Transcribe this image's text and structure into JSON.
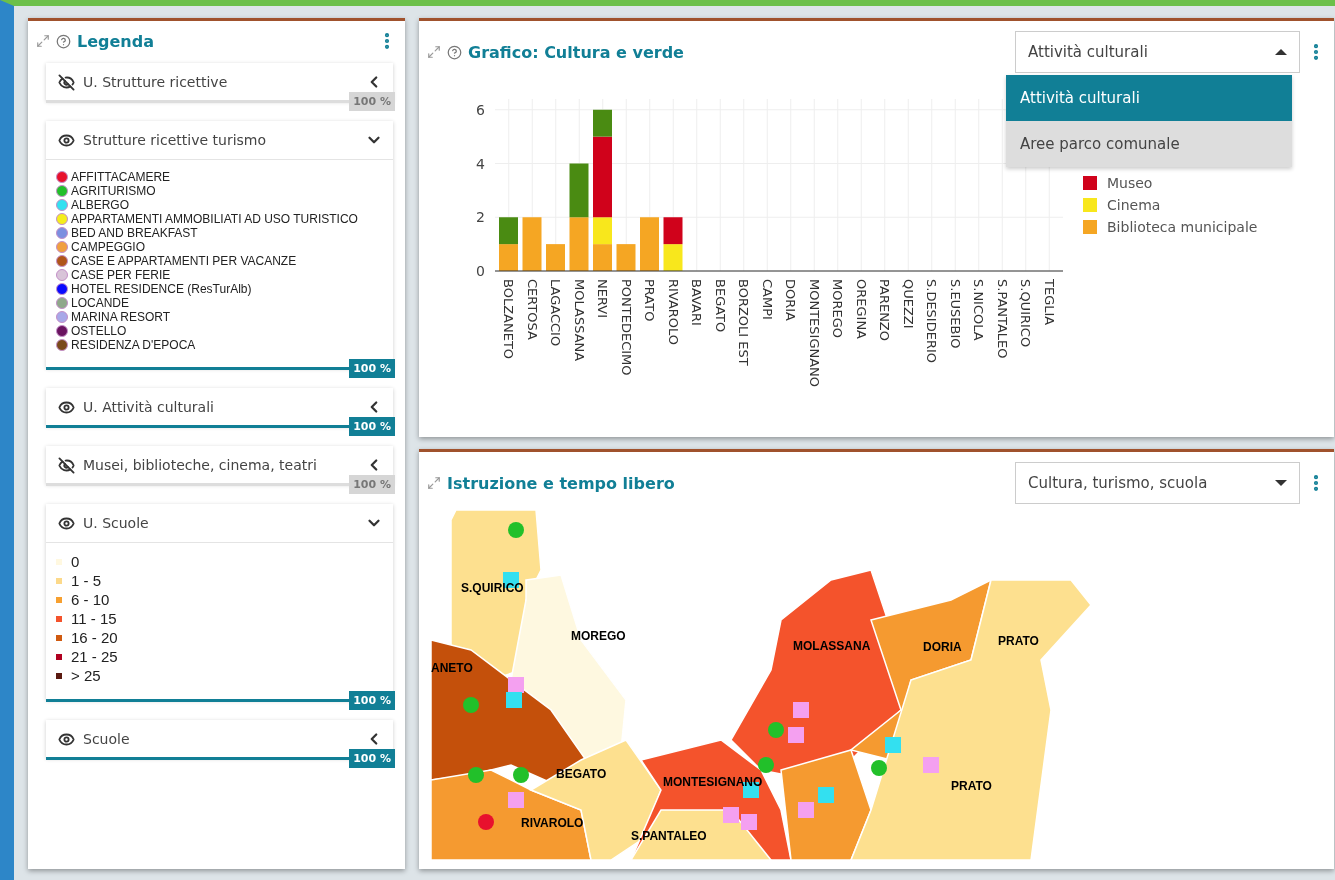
{
  "legend": {
    "title": "Legenda",
    "layers": [
      {
        "name": "U. Strutture ricettive",
        "visible": false,
        "expanded": false,
        "level": 1,
        "reading": "100 %"
      },
      {
        "name": "Strutture ricettive turismo",
        "visible": true,
        "expanded": true,
        "level": 1,
        "reading": "100 %",
        "kind": "points",
        "items": [
          {
            "label": "AFFITTACAMERE",
            "color": "#e8112d"
          },
          {
            "label": "AGRITURISMO",
            "color": "#22c02a"
          },
          {
            "label": "ALBERGO",
            "color": "#33e0f0"
          },
          {
            "label": "APPARTAMENTI AMMOBILIATI AD USO TURISTICO",
            "color": "#f5ee1c"
          },
          {
            "label": "BED AND BREAKFAST",
            "color": "#7b8fe0"
          },
          {
            "label": "CAMPEGGIO",
            "color": "#f0a040"
          },
          {
            "label": "CASE E APPARTAMENTI PER VACANZE",
            "color": "#b0561a"
          },
          {
            "label": "CASE PER FERIE",
            "color": "#d8c4d8"
          },
          {
            "label": "HOTEL RESIDENCE (ResTurAlb)",
            "color": "#0a0aff"
          },
          {
            "label": "LOCANDE",
            "color": "#8fa88a"
          },
          {
            "label": "MARINA RESORT",
            "color": "#a8a8e8"
          },
          {
            "label": "OSTELLO",
            "color": "#6a1460"
          },
          {
            "label": "RESIDENZA D'EPOCA",
            "color": "#7a4a1a"
          }
        ]
      },
      {
        "name": "U. Attività culturali",
        "visible": true,
        "expanded": false,
        "level": 1,
        "reading": "100 %"
      },
      {
        "name": "Musei, biblioteche, cinema, teatri",
        "visible": false,
        "expanded": false,
        "level": 1,
        "reading": "100 %"
      },
      {
        "name": "U. Scuole",
        "visible": true,
        "expanded": true,
        "level": 1,
        "reading": "100 %",
        "kind": "classes",
        "items": [
          {
            "label": "0",
            "color": "#fff8e0"
          },
          {
            "label": "1 - 5",
            "color": "#fcd98a"
          },
          {
            "label": "6 - 10",
            "color": "#f7a030"
          },
          {
            "label": "11 - 15",
            "color": "#f4532c"
          },
          {
            "label": "16 - 20",
            "color": "#d05a10"
          },
          {
            "label": "21 - 25",
            "color": "#b00020"
          },
          {
            "label": "> 25",
            "color": "#5a1a10"
          }
        ]
      },
      {
        "name": "Scuole",
        "visible": true,
        "expanded": false,
        "level": 1,
        "reading": "100 %"
      }
    ]
  },
  "chart_panel": {
    "title": "Grafico: Cultura e verde",
    "dropdown": {
      "value": "Attività culturali",
      "expanded": true,
      "options": [
        {
          "label": "Attività culturali",
          "selected": true
        },
        {
          "label": "Aree parco comunale",
          "selected": false
        }
      ]
    },
    "chart_data": {
      "type": "bar",
      "stacked": true,
      "grid": true,
      "categories": [
        "BOLZANETO",
        "CERTOSA",
        "LAGACCIO",
        "MOLASSANA",
        "NERVI",
        "PONTEDECIMO",
        "PRATO",
        "RIVAROLO",
        "BAVARI",
        "BEGATO",
        "BORZOLI EST",
        "CAMPI",
        "DORIA",
        "MONTESIGNANO",
        "MOREGO",
        "OREGINA",
        "PARENZO",
        "QUEZZI",
        "S.DESIDERIO",
        "S.EUSEBIO",
        "S.NICOLA",
        "S.PANTALEO",
        "S.QUIRICO",
        "TEGLIA"
      ],
      "ylim": [
        0,
        6.4
      ],
      "yticks": [
        0,
        2,
        4,
        6
      ],
      "series": [
        {
          "name": "Biblioteca municipale",
          "color": "#f5a623",
          "values": [
            1,
            2,
            1,
            2,
            1,
            1,
            2,
            0,
            0,
            0,
            0,
            0,
            0,
            0,
            0,
            0,
            0,
            0,
            0,
            0,
            0,
            0,
            0,
            0
          ]
        },
        {
          "name": "Cinema",
          "color": "#f8e71c",
          "values": [
            0,
            0,
            0,
            0,
            1,
            0,
            0,
            1,
            0,
            0,
            0,
            0,
            0,
            0,
            0,
            0,
            0,
            0,
            0,
            0,
            0,
            0,
            0,
            0
          ]
        },
        {
          "name": "Museo",
          "color": "#d0021b",
          "values": [
            0,
            0,
            0,
            0,
            3,
            0,
            0,
            1,
            0,
            0,
            0,
            0,
            0,
            0,
            0,
            0,
            0,
            0,
            0,
            0,
            0,
            0,
            0,
            0
          ]
        },
        {
          "color": "#4a8b12",
          "values": [
            1,
            0,
            0,
            2,
            1,
            0,
            0,
            0,
            0,
            0,
            0,
            0,
            0,
            0,
            0,
            0,
            0,
            0,
            0,
            0,
            0,
            0,
            0,
            0
          ]
        }
      ]
    }
  },
  "map_panel": {
    "title": "Istruzione e tempo libero",
    "dropdown": {
      "value": "Cultura, turismo, scuola",
      "expanded": false
    },
    "map_labels": [
      "S.QUIRICO",
      "MOREGO",
      "ANETO",
      "MOLASSANA",
      "DORIA",
      "PRATO",
      "BEGATO",
      "MONTESIGNANO",
      "PRATO",
      "RIVAROLO",
      "S.PANTALEO"
    ]
  }
}
